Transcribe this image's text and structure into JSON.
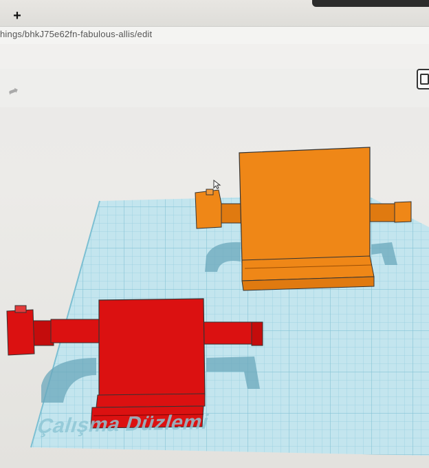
{
  "browser": {
    "new_tab_symbol": "+",
    "url": "hings/bhkJ75e62fn-fabulous-allis/edit"
  },
  "toolbar": {
    "redo_icon": "redo-arrow-icon",
    "right_tool_icon": "copy-icon"
  },
  "workplane": {
    "label": "Çalışma Düzlemi",
    "grid_color": "#bfe4ee",
    "line_color": "#8fcadb"
  },
  "objects": [
    {
      "name": "orange-chair",
      "color": "#ef8717"
    },
    {
      "name": "red-chair",
      "color": "#db1111"
    }
  ]
}
